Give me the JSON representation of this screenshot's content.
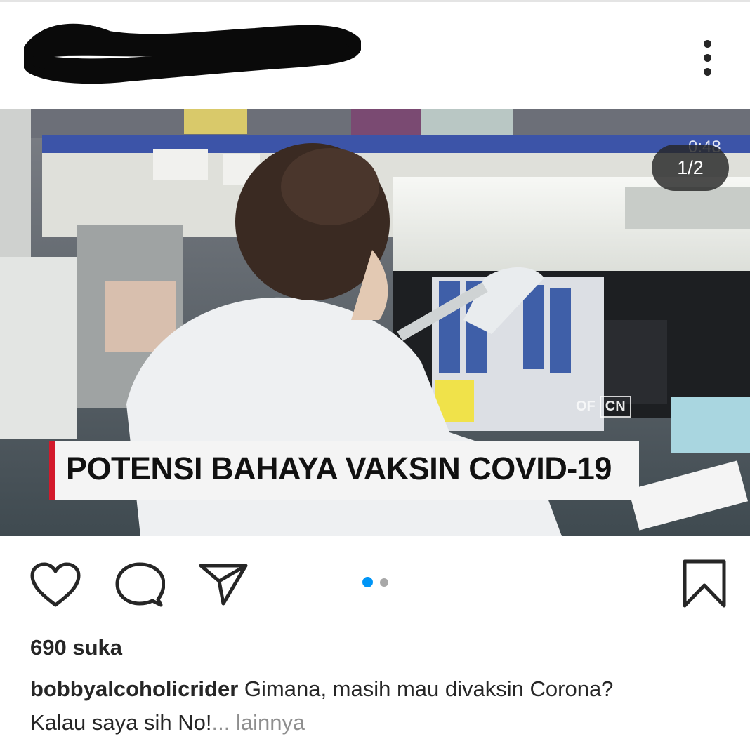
{
  "post": {
    "image_counter": "1/2",
    "video_timer": "0:48",
    "headline": "POTENSI BAHAYA VAKSIN COVID-19",
    "logo_of": "OF",
    "logo_network": "CN",
    "carousel": {
      "total": 2,
      "active_index": 0
    },
    "likes_text": "690 suka",
    "caption": {
      "username": "bobbyalcoholicrider",
      "text_line1": "Gimana, masih mau divaksin Corona?",
      "text_line2": "Kalau saya sih No!",
      "ellipsis": "...",
      "more_label": "lainnya"
    }
  },
  "icons": {
    "menu": "more-vertical-icon",
    "like": "heart-icon",
    "comment": "comment-icon",
    "share": "send-icon",
    "save": "bookmark-icon"
  },
  "colors": {
    "text": "#262626",
    "muted": "#8e8e8e",
    "accent": "#0095f6",
    "dot_inactive": "#a8a8a8",
    "headline_bar": "#d3192b"
  }
}
